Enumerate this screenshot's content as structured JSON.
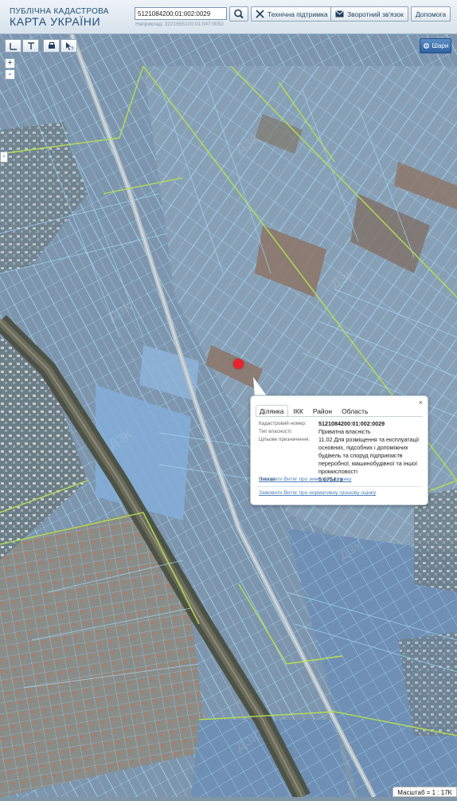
{
  "header": {
    "logo_line1": "ПУБЛІЧНА КАДАСТРОВА",
    "logo_line2": "КАРТА УКРАЇНИ"
  },
  "search": {
    "value": "5121084200:01:002:0029",
    "hint": "Наприклад: 3221655100:01:047:0052"
  },
  "toolbar": {
    "support": "Технічна підтримка",
    "feedback": "Зворотний зв'язок",
    "help": "Допомога"
  },
  "map_controls": {
    "zoom_in": "+",
    "zoom_out": "-",
    "side_tab": "›",
    "layers": "Шари"
  },
  "popup": {
    "tabs": [
      "Ділянка",
      "ІКК",
      "Район",
      "Область"
    ],
    "active_tab": "Ділянка",
    "close": "×",
    "rows": [
      {
        "label": "Кадастровий номер:",
        "value": "5121084200:01:002:0029"
      },
      {
        "label": "Тип власності:",
        "value": "Приватна власність"
      },
      {
        "label": "Цільове призначення:",
        "value": "11.02 Для розміщення та експлуатації основних, підсобних і допоміжних будівель та споруд підприємств переробної, машинобудівної та іншої промисловості"
      },
      {
        "label": "Площа:",
        "value": "5.6754 га"
      }
    ],
    "link1": "Замовити Витяг про земельну ділянку",
    "link2": "Замовити Витяг про нормативну грошову оцінку"
  },
  "scale": "Масштаб = 1 : 17K",
  "colors": {
    "parcel_line": "#9cd6f2",
    "boundary_line": "#b5e04e",
    "marker": "#e8232e",
    "header_text": "#1f4e79"
  }
}
